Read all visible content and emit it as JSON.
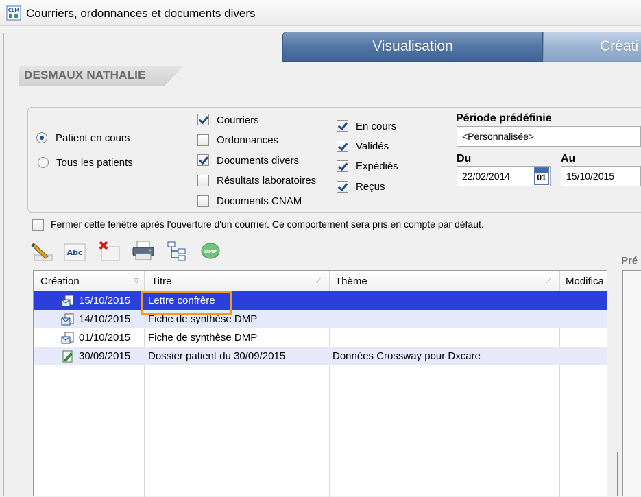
{
  "window": {
    "title": "Courriers, ordonnances et documents divers",
    "app_icon": "clm-app-icon"
  },
  "tabs": [
    {
      "label": "Visualisation",
      "active": true
    },
    {
      "label": "Créati",
      "active": false
    }
  ],
  "patient": {
    "name": "DESMAUX NATHALIE"
  },
  "filters": {
    "scope": [
      {
        "label": "Patient en cours",
        "selected": true
      },
      {
        "label": "Tous les patients",
        "selected": false
      }
    ],
    "types": [
      {
        "label": "Courriers",
        "checked": true
      },
      {
        "label": "Ordonnances",
        "checked": false
      },
      {
        "label": "Documents divers",
        "checked": true
      },
      {
        "label": "Résultats laboratoires",
        "checked": false
      },
      {
        "label": "Documents CNAM",
        "checked": false
      }
    ],
    "statuses": [
      {
        "label": "En cours",
        "checked": true
      },
      {
        "label": "Validés",
        "checked": true
      },
      {
        "label": "Expédiés",
        "checked": true
      },
      {
        "label": "Reçus",
        "checked": true
      }
    ],
    "period_label": "Période prédéfinie",
    "period_value": "<Personnalisée>",
    "from_label": "Du",
    "from_value": "22/02/2014",
    "to_label": "Au",
    "to_value": "15/10/2015",
    "calendar_icon_text": "01"
  },
  "close_option": {
    "label": "Fermer cette fenêtre après l'ouverture d'un courrier. Ce comportement sera pris en compte par défaut.",
    "checked": false
  },
  "toolbar": [
    {
      "icon": "edit-pencil-icon"
    },
    {
      "icon": "spellcheck-abc-icon",
      "text": "Abc"
    },
    {
      "icon": "delete-icon"
    },
    {
      "icon": "print-icon"
    },
    {
      "icon": "tree-structure-icon"
    },
    {
      "icon": "dmp-icon",
      "text": "DMP"
    }
  ],
  "grid": {
    "columns": [
      "Création",
      "Titre",
      "Thème",
      "Modifica"
    ],
    "rows": [
      {
        "date": "15/10/2015",
        "title": "Lettre confrère",
        "theme": "",
        "icon": "letter-icon",
        "selected": true
      },
      {
        "date": "14/10/2015",
        "title": "Fiche de synthèse DMP",
        "theme": "",
        "icon": "letter-icon",
        "selected": false
      },
      {
        "date": "01/10/2015",
        "title": "Fiche de synthèse DMP",
        "theme": "",
        "icon": "letter-icon",
        "selected": false
      },
      {
        "date": "30/09/2015",
        "title": "Dossier patient du 30/09/2015",
        "theme": "Données Crossway pour Dxcare",
        "icon": "document-pen-icon",
        "selected": false
      }
    ]
  },
  "preview": {
    "label": "Pré"
  },
  "colors": {
    "selection": "#2b3fdc",
    "alt_row": "#e6e9f9",
    "highlight": "#f59b1a",
    "tab_active": "#4f6f9f"
  }
}
